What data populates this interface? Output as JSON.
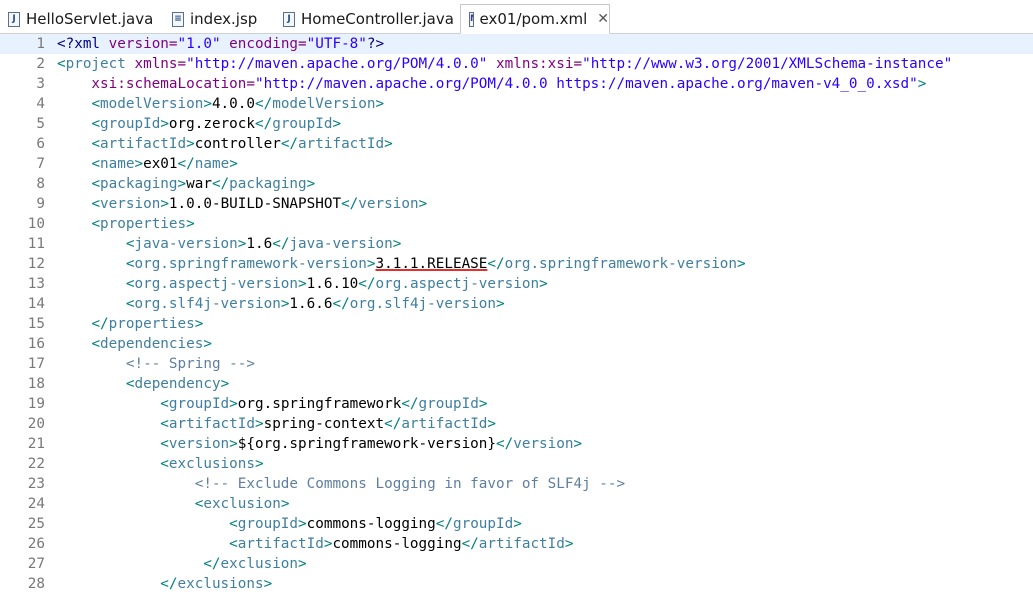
{
  "tabs": [
    {
      "label": "HelloServlet.java",
      "icon": "java-file-icon",
      "active": false
    },
    {
      "label": "index.jsp",
      "icon": "jsp-file-icon",
      "active": false
    },
    {
      "label": "HomeController.java",
      "icon": "java-file-icon",
      "active": false
    },
    {
      "label": "ex01/pom.xml",
      "icon": "maven-pom-file-icon",
      "active": true,
      "close": "✕"
    }
  ],
  "lines": [
    {
      "n": "1",
      "segs": [
        [
          "pi",
          "<?xml"
        ],
        [
          "attr",
          " version="
        ],
        [
          "value",
          "\"1.0\""
        ],
        [
          "attr",
          " encoding="
        ],
        [
          "value",
          "\"UTF-8\""
        ],
        [
          "pi",
          "?>"
        ]
      ]
    },
    {
      "n": "2",
      "segs": [
        [
          "bracket",
          "<"
        ],
        [
          "tag",
          "project"
        ],
        [
          "attr",
          " xmlns="
        ],
        [
          "value",
          "\"http://maven.apache.org/POM/4.0.0\""
        ],
        [
          "attr",
          " xmlns:xsi="
        ],
        [
          "value",
          "\"http://www.w3.org/2001/XMLSchema-instance\""
        ]
      ]
    },
    {
      "n": "3",
      "segs": [
        [
          "attr",
          "    xsi:schemaLocation="
        ],
        [
          "value",
          "\"http://maven.apache.org/POM/4.0.0 https://maven.apache.org/maven-v4_0_0.xsd\""
        ],
        [
          "bracket",
          ">"
        ]
      ]
    },
    {
      "n": "4",
      "segs": [
        [
          "text",
          "    "
        ],
        [
          "bracket",
          "<"
        ],
        [
          "tag",
          "modelVersion"
        ],
        [
          "bracket",
          ">"
        ],
        [
          "text",
          "4.0.0"
        ],
        [
          "bracket",
          "</"
        ],
        [
          "tag",
          "modelVersion"
        ],
        [
          "bracket",
          ">"
        ]
      ]
    },
    {
      "n": "5",
      "segs": [
        [
          "text",
          "    "
        ],
        [
          "bracket",
          "<"
        ],
        [
          "tag",
          "groupId"
        ],
        [
          "bracket",
          ">"
        ],
        [
          "text",
          "org.zerock"
        ],
        [
          "bracket",
          "</"
        ],
        [
          "tag",
          "groupId"
        ],
        [
          "bracket",
          ">"
        ]
      ]
    },
    {
      "n": "6",
      "segs": [
        [
          "text",
          "    "
        ],
        [
          "bracket",
          "<"
        ],
        [
          "tag",
          "artifactId"
        ],
        [
          "bracket",
          ">"
        ],
        [
          "text",
          "controller"
        ],
        [
          "bracket",
          "</"
        ],
        [
          "tag",
          "artifactId"
        ],
        [
          "bracket",
          ">"
        ]
      ]
    },
    {
      "n": "7",
      "segs": [
        [
          "text",
          "    "
        ],
        [
          "bracket",
          "<"
        ],
        [
          "tag",
          "name"
        ],
        [
          "bracket",
          ">"
        ],
        [
          "text",
          "ex01"
        ],
        [
          "bracket",
          "</"
        ],
        [
          "tag",
          "name"
        ],
        [
          "bracket",
          ">"
        ]
      ]
    },
    {
      "n": "8",
      "segs": [
        [
          "text",
          "    "
        ],
        [
          "bracket",
          "<"
        ],
        [
          "tag",
          "packaging"
        ],
        [
          "bracket",
          ">"
        ],
        [
          "text",
          "war"
        ],
        [
          "bracket",
          "</"
        ],
        [
          "tag",
          "packaging"
        ],
        [
          "bracket",
          ">"
        ]
      ]
    },
    {
      "n": "9",
      "segs": [
        [
          "text",
          "    "
        ],
        [
          "bracket",
          "<"
        ],
        [
          "tag",
          "version"
        ],
        [
          "bracket",
          ">"
        ],
        [
          "text",
          "1.0.0-BUILD-SNAPSHOT"
        ],
        [
          "bracket",
          "</"
        ],
        [
          "tag",
          "version"
        ],
        [
          "bracket",
          ">"
        ]
      ]
    },
    {
      "n": "10",
      "segs": [
        [
          "text",
          "    "
        ],
        [
          "bracket",
          "<"
        ],
        [
          "tag",
          "properties"
        ],
        [
          "bracket",
          ">"
        ]
      ]
    },
    {
      "n": "11",
      "segs": [
        [
          "text",
          "        "
        ],
        [
          "bracket",
          "<"
        ],
        [
          "tag",
          "java-version"
        ],
        [
          "bracket",
          ">"
        ],
        [
          "text",
          "1.6"
        ],
        [
          "bracket",
          "</"
        ],
        [
          "tag",
          "java-version"
        ],
        [
          "bracket",
          ">"
        ]
      ]
    },
    {
      "n": "12",
      "segs": [
        [
          "text",
          "        "
        ],
        [
          "bracket",
          "<"
        ],
        [
          "tag",
          "org.springframework-version"
        ],
        [
          "bracket",
          ">"
        ],
        [
          "text",
          "3.1.1.RELEASE"
        ],
        [
          "bracket",
          "</"
        ],
        [
          "tag",
          "org.springframework-version"
        ],
        [
          "bracket",
          ">"
        ]
      ]
    },
    {
      "n": "13",
      "segs": [
        [
          "text",
          "        "
        ],
        [
          "bracket",
          "<"
        ],
        [
          "tag",
          "org.aspectj-version"
        ],
        [
          "bracket",
          ">"
        ],
        [
          "text",
          "1.6.10"
        ],
        [
          "bracket",
          "</"
        ],
        [
          "tag",
          "org.aspectj-version"
        ],
        [
          "bracket",
          ">"
        ]
      ]
    },
    {
      "n": "14",
      "segs": [
        [
          "text",
          "        "
        ],
        [
          "bracket",
          "<"
        ],
        [
          "tag",
          "org.slf4j-version"
        ],
        [
          "bracket",
          ">"
        ],
        [
          "text",
          "1.6.6"
        ],
        [
          "bracket",
          "</"
        ],
        [
          "tag",
          "org.slf4j-version"
        ],
        [
          "bracket",
          ">"
        ]
      ]
    },
    {
      "n": "15",
      "segs": [
        [
          "text",
          "    "
        ],
        [
          "bracket",
          "</"
        ],
        [
          "tag",
          "properties"
        ],
        [
          "bracket",
          ">"
        ]
      ]
    },
    {
      "n": "16",
      "segs": [
        [
          "text",
          "    "
        ],
        [
          "bracket",
          "<"
        ],
        [
          "tag",
          "dependencies"
        ],
        [
          "bracket",
          ">"
        ]
      ]
    },
    {
      "n": "17",
      "segs": [
        [
          "text",
          "        "
        ],
        [
          "comment",
          "<!-- Spring -->"
        ]
      ]
    },
    {
      "n": "18",
      "segs": [
        [
          "text",
          "        "
        ],
        [
          "bracket",
          "<"
        ],
        [
          "tag",
          "dependency"
        ],
        [
          "bracket",
          ">"
        ]
      ]
    },
    {
      "n": "19",
      "segs": [
        [
          "text",
          "            "
        ],
        [
          "bracket",
          "<"
        ],
        [
          "tag",
          "groupId"
        ],
        [
          "bracket",
          ">"
        ],
        [
          "text",
          "org.springframework"
        ],
        [
          "bracket",
          "</"
        ],
        [
          "tag",
          "groupId"
        ],
        [
          "bracket",
          ">"
        ]
      ]
    },
    {
      "n": "20",
      "segs": [
        [
          "text",
          "            "
        ],
        [
          "bracket",
          "<"
        ],
        [
          "tag",
          "artifactId"
        ],
        [
          "bracket",
          ">"
        ],
        [
          "text",
          "spring-context"
        ],
        [
          "bracket",
          "</"
        ],
        [
          "tag",
          "artifactId"
        ],
        [
          "bracket",
          ">"
        ]
      ]
    },
    {
      "n": "21",
      "segs": [
        [
          "text",
          "            "
        ],
        [
          "bracket",
          "<"
        ],
        [
          "tag",
          "version"
        ],
        [
          "bracket",
          ">"
        ],
        [
          "text",
          "${org.springframework-version}"
        ],
        [
          "bracket",
          "</"
        ],
        [
          "tag",
          "version"
        ],
        [
          "bracket",
          ">"
        ]
      ]
    },
    {
      "n": "22",
      "segs": [
        [
          "text",
          "            "
        ],
        [
          "bracket",
          "<"
        ],
        [
          "tag",
          "exclusions"
        ],
        [
          "bracket",
          ">"
        ]
      ]
    },
    {
      "n": "23",
      "segs": [
        [
          "text",
          "                "
        ],
        [
          "comment",
          "<!-- Exclude Commons Logging in favor of SLF4j -->"
        ]
      ]
    },
    {
      "n": "24",
      "segs": [
        [
          "text",
          "                "
        ],
        [
          "bracket",
          "<"
        ],
        [
          "tag",
          "exclusion"
        ],
        [
          "bracket",
          ">"
        ]
      ]
    },
    {
      "n": "25",
      "segs": [
        [
          "text",
          "                    "
        ],
        [
          "bracket",
          "<"
        ],
        [
          "tag",
          "groupId"
        ],
        [
          "bracket",
          ">"
        ],
        [
          "text",
          "commons-logging"
        ],
        [
          "bracket",
          "</"
        ],
        [
          "tag",
          "groupId"
        ],
        [
          "bracket",
          ">"
        ]
      ]
    },
    {
      "n": "26",
      "segs": [
        [
          "text",
          "                    "
        ],
        [
          "bracket",
          "<"
        ],
        [
          "tag",
          "artifactId"
        ],
        [
          "bracket",
          ">"
        ],
        [
          "text",
          "commons-logging"
        ],
        [
          "bracket",
          "</"
        ],
        [
          "tag",
          "artifactId"
        ],
        [
          "bracket",
          ">"
        ]
      ]
    },
    {
      "n": "27",
      "segs": [
        [
          "text",
          "                 "
        ],
        [
          "bracket",
          "</"
        ],
        [
          "tag",
          "exclusion"
        ],
        [
          "bracket",
          ">"
        ]
      ]
    },
    {
      "n": "28",
      "segs": [
        [
          "text",
          "            "
        ],
        [
          "bracket",
          "</"
        ],
        [
          "tag",
          "exclusions"
        ],
        [
          "bracket",
          ">"
        ]
      ]
    }
  ],
  "current_line": "1",
  "underlined": {
    "line": "12",
    "text": "3.1.1.RELEASE",
    "color": "#e03030"
  },
  "colors": {
    "tag": "#3f7f9f",
    "bracket": "#008080",
    "attr": "#7f007f",
    "value": "#2a00ff",
    "text": "#000000",
    "comment": "#5f7f9f",
    "line_number": "#787878",
    "current_line_bg": "#e8f2fe"
  }
}
